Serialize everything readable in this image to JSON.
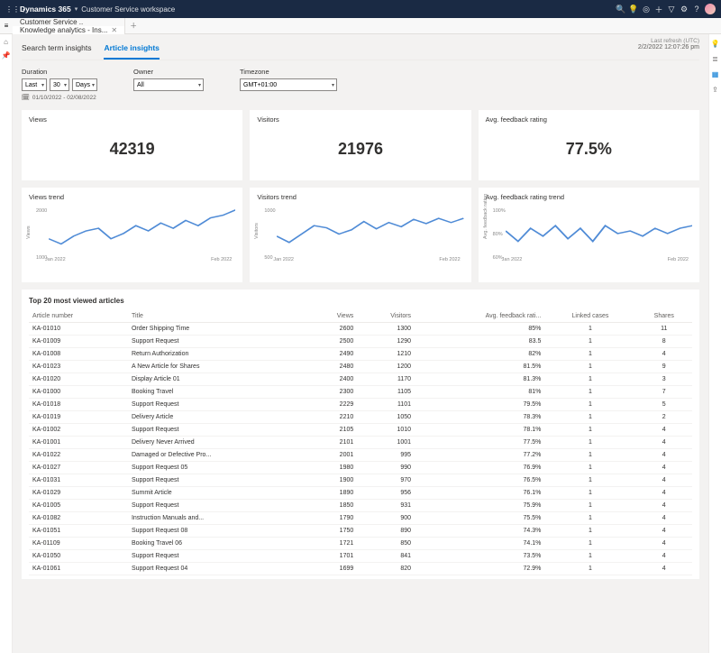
{
  "header": {
    "brand": "Dynamics 365",
    "workspace": "Customer Service workspace",
    "icons": [
      "search",
      "bulb",
      "target",
      "plus",
      "filter",
      "gear",
      "help"
    ]
  },
  "tabs": [
    {
      "label": "Customer Service ..",
      "active": false,
      "closable": false
    },
    {
      "label": "Knowledge analytics - Ins...",
      "active": true,
      "closable": true
    }
  ],
  "subtabs": {
    "search_term": "Search term insights",
    "article": "Article insights"
  },
  "refresh": {
    "label": "Last refresh (UTC)",
    "value": "2/2/2022 12:07:26 pm"
  },
  "filters": {
    "duration_label": "Duration",
    "duration_mode": "Last",
    "duration_value": "30",
    "duration_unit": "Days",
    "date_range": "01/10/2022 - 02/08/2022",
    "owner_label": "Owner",
    "owner_value": "All",
    "timezone_label": "Timezone",
    "timezone_value": "GMT+01:00"
  },
  "kpi": {
    "views_label": "Views",
    "views_value": "42319",
    "visitors_label": "Visitors",
    "visitors_value": "21976",
    "rating_label": "Avg. feedback rating",
    "rating_value": "77.5%"
  },
  "trend_labels": {
    "views": "Views trend",
    "visitors": "Visitors trend",
    "rating": "Avg. feedback rating trend",
    "xstart": "Jan 2022",
    "xend": "Feb 2022",
    "views_ylabel": "Views",
    "visitors_ylabel": "Visitors",
    "rating_ylabel": "Avg. feedback rating"
  },
  "chart_data": [
    {
      "type": "line",
      "title": "Views trend",
      "xlabel": "",
      "ylabel": "Views",
      "ylim": [
        1000,
        2000
      ],
      "yticks": [
        "2000",
        "1000"
      ],
      "x": [
        0,
        1,
        2,
        3,
        4,
        5,
        6,
        7,
        8,
        9,
        10,
        11,
        12,
        13,
        14,
        15
      ],
      "values": [
        1350,
        1250,
        1400,
        1500,
        1550,
        1350,
        1450,
        1600,
        1500,
        1650,
        1550,
        1700,
        1600,
        1750,
        1800,
        1900
      ]
    },
    {
      "type": "line",
      "title": "Visitors trend",
      "xlabel": "",
      "ylabel": "Visitors",
      "ylim": [
        500,
        1000
      ],
      "yticks": [
        "1000",
        "500"
      ],
      "x": [
        0,
        1,
        2,
        3,
        4,
        5,
        6,
        7,
        8,
        9,
        10,
        11,
        12,
        13,
        14,
        15
      ],
      "values": [
        700,
        640,
        720,
        800,
        780,
        720,
        760,
        840,
        770,
        830,
        790,
        860,
        820,
        870,
        830,
        870
      ]
    },
    {
      "type": "line",
      "title": "Avg. feedback rating trend",
      "xlabel": "",
      "ylabel": "Avg. feedback rating",
      "ylim": [
        60,
        100
      ],
      "yticks": [
        "100%",
        "80%",
        "60%"
      ],
      "x": [
        0,
        1,
        2,
        3,
        4,
        5,
        6,
        7,
        8,
        9,
        10,
        11,
        12,
        13,
        14,
        15
      ],
      "values": [
        80,
        72,
        82,
        76,
        84,
        74,
        82,
        72,
        84,
        78,
        80,
        76,
        82,
        78,
        82,
        84
      ]
    }
  ],
  "table": {
    "title": "Top 20 most viewed articles",
    "columns": [
      "Article number",
      "Title",
      "Views",
      "Visitors",
      "Avg. feedback rati...",
      "Linked cases",
      "Shares"
    ],
    "rows": [
      [
        "KA-01010",
        "Order Shipping Time",
        "2600",
        "1300",
        "85%",
        "1",
        "11"
      ],
      [
        "KA-01009",
        "Support Request",
        "2500",
        "1290",
        "83.5",
        "1",
        "8"
      ],
      [
        "KA-01008",
        "Return Authorization",
        "2490",
        "1210",
        "82%",
        "1",
        "4"
      ],
      [
        "KA-01023",
        "A New Article for Shares",
        "2480",
        "1200",
        "81.5%",
        "1",
        "9"
      ],
      [
        "KA-01020",
        "Display Article 01",
        "2400",
        "1170",
        "81.3%",
        "1",
        "3"
      ],
      [
        "KA-01000",
        "Booking Travel",
        "2300",
        "1105",
        "81%",
        "1",
        "7"
      ],
      [
        "KA-01018",
        "Support Request",
        "2229",
        "1101",
        "79.5%",
        "1",
        "5"
      ],
      [
        "KA-01019",
        "Delivery Article",
        "2210",
        "1050",
        "78.3%",
        "1",
        "2"
      ],
      [
        "KA-01002",
        "Support Request",
        "2105",
        "1010",
        "78.1%",
        "1",
        "4"
      ],
      [
        "KA-01001",
        "Delivery Never Arrived",
        "2101",
        "1001",
        "77.5%",
        "1",
        "4"
      ],
      [
        "KA-01022",
        "Damaged or Defective Pro...",
        "2001",
        "995",
        "77.2%",
        "1",
        "4"
      ],
      [
        "KA-01027",
        "Support Request 05",
        "1980",
        "990",
        "76.9%",
        "1",
        "4"
      ],
      [
        "KA-01031",
        "Support Request",
        "1900",
        "970",
        "76.5%",
        "1",
        "4"
      ],
      [
        "KA-01029",
        "Summit Article",
        "1890",
        "956",
        "76.1%",
        "1",
        "4"
      ],
      [
        "KA-01005",
        "Support Request",
        "1850",
        "931",
        "75.9%",
        "1",
        "4"
      ],
      [
        "KA-01082",
        "Instruction Manuals and...",
        "1790",
        "900",
        "75.5%",
        "1",
        "4"
      ],
      [
        "KA-01051",
        "Support Request 08",
        "1750",
        "890",
        "74.3%",
        "1",
        "4"
      ],
      [
        "KA-01109",
        "Booking Travel 06",
        "1721",
        "850",
        "74.1%",
        "1",
        "4"
      ],
      [
        "KA-01050",
        "Support Request",
        "1701",
        "841",
        "73.5%",
        "1",
        "4"
      ],
      [
        "KA-01061",
        "Support Request 04",
        "1699",
        "820",
        "72.9%",
        "1",
        "4"
      ]
    ]
  }
}
